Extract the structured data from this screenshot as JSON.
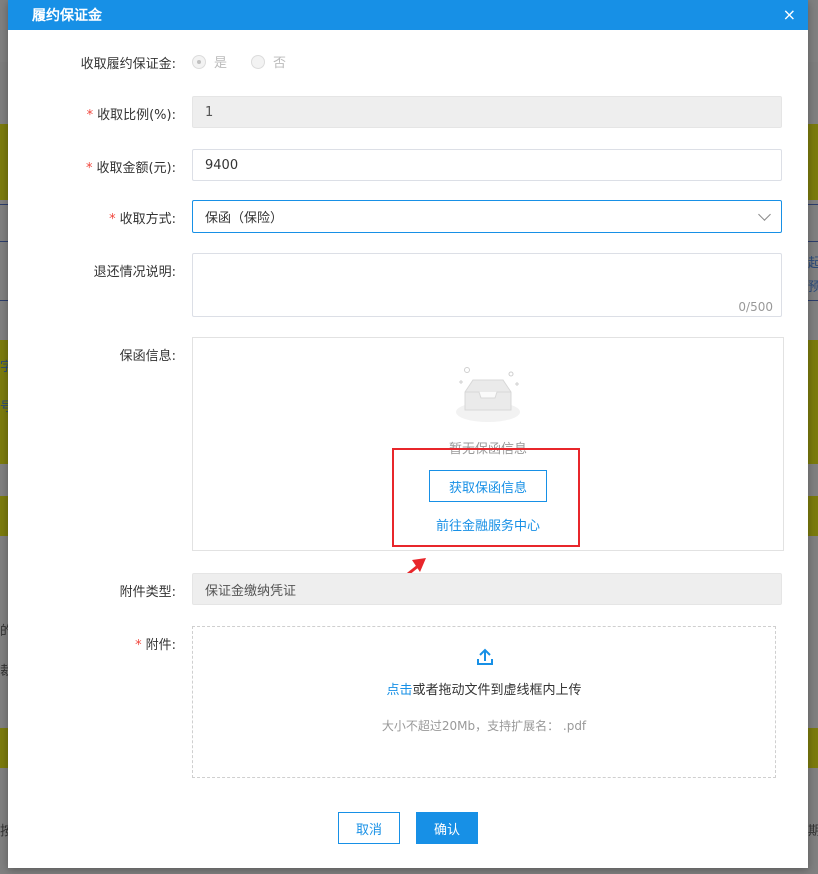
{
  "background": {
    "fragments": [
      "字",
      "号",
      "起",
      "预",
      "的",
      "裁",
      "按",
      "期"
    ]
  },
  "dialog": {
    "title": "履约保证金",
    "close_glyph": "×"
  },
  "form": {
    "collect_deposit": {
      "label": "收取履约保证金:",
      "options": [
        {
          "label": "是",
          "checked": true
        },
        {
          "label": "否",
          "checked": false
        }
      ]
    },
    "ratio": {
      "required_mark": "*",
      "label": "收取比例(%):",
      "value": "1"
    },
    "amount": {
      "required_mark": "*",
      "label": "收取金额(元):",
      "value": "9400"
    },
    "method": {
      "required_mark": "*",
      "label": "收取方式:",
      "value": "保函（保险）"
    },
    "refund_note": {
      "label": "退还情况说明:",
      "value": "",
      "counter": "0/500"
    },
    "guarantee_info": {
      "label": "保函信息:",
      "empty_text": "暂无保函信息",
      "fetch_button": "获取保函信息",
      "finance_link": "前往金融服务中心"
    },
    "attachment_type": {
      "label": "附件类型:",
      "value": "保证金缴纳凭证"
    },
    "attachment": {
      "required_mark": "*",
      "label": "附件:",
      "click_text": "点击",
      "drag_text": "或者拖动文件到虚线框内上传",
      "hint": "大小不超过20Mb，支持扩展名： .pdf"
    }
  },
  "footer": {
    "cancel": "取消",
    "confirm": "确认"
  },
  "colors": {
    "primary": "#1790e6",
    "required": "#f0443b",
    "highlight": "#e8262b"
  }
}
